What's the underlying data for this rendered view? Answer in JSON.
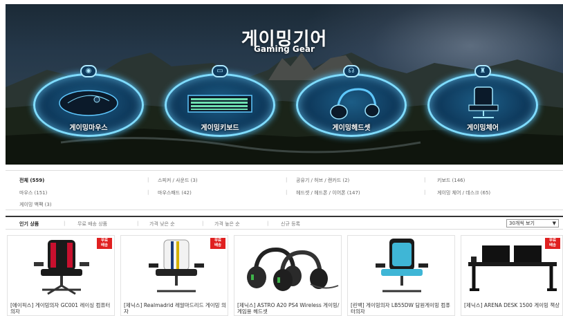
{
  "hero": {
    "title": "게이밍기어",
    "subtitle": "Gaming Gear",
    "categories": [
      {
        "label": "게이밍마우스",
        "icon": "mouse-icon"
      },
      {
        "label": "게이밍키보드",
        "icon": "keyboard-icon"
      },
      {
        "label": "게이밍헤드셋",
        "icon": "headset-icon"
      },
      {
        "label": "게이밍체어",
        "icon": "chair-icon"
      }
    ]
  },
  "filters": [
    {
      "label": "전체 (559)",
      "active": true
    },
    {
      "label": "스피커 / 사운드 (3)"
    },
    {
      "label": "공유기 / 허브 / 랜카드 (2)"
    },
    {
      "label": "키보드 (146)"
    },
    {
      "label": "마우스 (151)"
    },
    {
      "label": "마우스패드 (42)"
    },
    {
      "label": "헤드셋 / 헤드폰 / 이어폰 (147)"
    },
    {
      "label": "게이밍 체어 / 데스크 (65)"
    },
    {
      "label": "게이밍 백팩 (3)"
    }
  ],
  "sort": {
    "options": [
      "인기 상품",
      "무료 배송 상품",
      "가격 낮은 순",
      "가격 높은 순",
      "신규 등록"
    ],
    "active": 0,
    "view_select": "30개씩 보기"
  },
  "products": [
    {
      "name": "[에이픽스] 게이밍의자 GC001 레이싱 컴퓨터의자",
      "free_shipping": "무료\n배송",
      "accent": "#c8102e"
    },
    {
      "name": "[제닉스] Realmadrid 레알마드리드 게이밍 의자",
      "free_shipping": "무료\n배송",
      "accent": "#e8e8e8"
    },
    {
      "name": "[제닉스] ASTRO A20 PS4 Wireless 게이밍/게임용 헤드셋",
      "free_shipping": "",
      "accent": "#2a2a2a"
    },
    {
      "name": "[린백] 게이밍의자 LB55DW 담원게이밍 컴퓨터의자",
      "free_shipping": "",
      "accent": "#3fb6d6"
    },
    {
      "name": "[제닉스] ARENA DESK 1500 게이밍 책상",
      "free_shipping": "무료\n배송",
      "accent": "#111111"
    }
  ]
}
